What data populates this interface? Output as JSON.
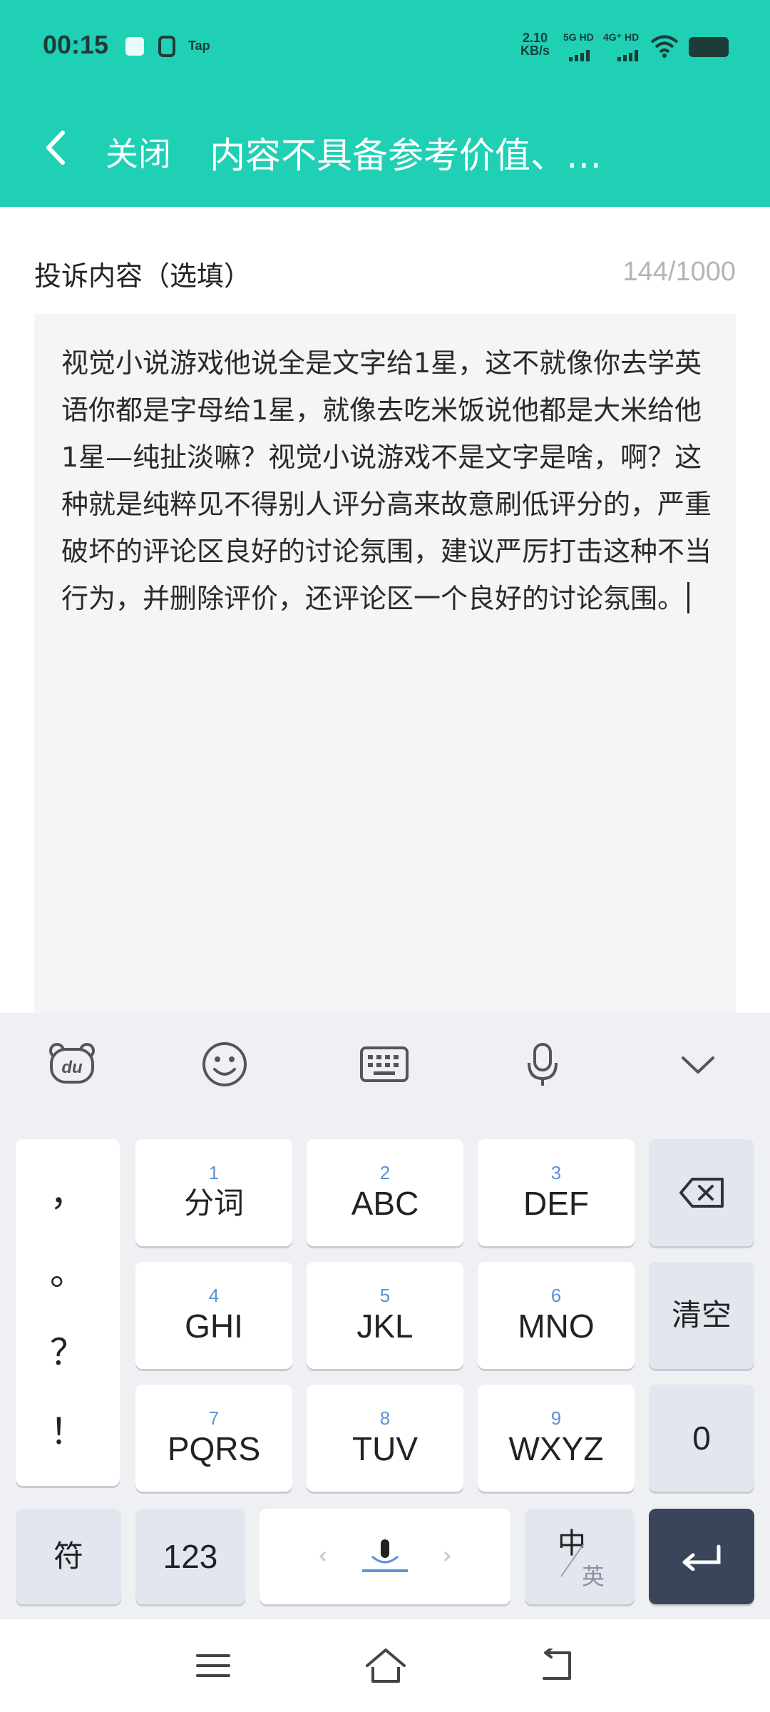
{
  "status_bar": {
    "time": "00:15",
    "app_icons": [
      "cloud-app-icon",
      "taptap-app-icon"
    ],
    "tap_label": "Tap",
    "net_speed_value": "2.10",
    "net_speed_unit": "KB/s",
    "sim1_label": "5G HD",
    "sim2_label": "4G⁺ HD",
    "battery_level": 1.0
  },
  "header": {
    "close_label": "关闭",
    "title": "内容不具备参考价值、…"
  },
  "form": {
    "label": "投诉内容（选填）",
    "counter": "144/1000",
    "content": "视觉小说游戏他说全是文字给1星，这不就像你去学英语你都是字母给1星，就像去吃米饭说他都是大米给他1星—纯扯淡嘛？视觉小说游戏不是文字是啥，啊？这种就是纯粹见不得别人评分高来故意刷低评分的，严重破坏的评论区良好的讨论氛围，建议严厉打击这种不当行为，并删除评价，还评论区一个良好的讨论氛围。"
  },
  "keyboard": {
    "toolbar": [
      "du-logo-icon",
      "emoji-icon",
      "keyboard-icon",
      "microphone-icon",
      "chevron-down-icon"
    ],
    "punctuation": [
      "，",
      "。",
      "？",
      "！"
    ],
    "keys": [
      {
        "num": "1",
        "label": "分词"
      },
      {
        "num": "2",
        "label": "ABC"
      },
      {
        "num": "3",
        "label": "DEF"
      },
      {
        "num": "4",
        "label": "GHI"
      },
      {
        "num": "5",
        "label": "JKL"
      },
      {
        "num": "6",
        "label": "MNO"
      },
      {
        "num": "7",
        "label": "PQRS"
      },
      {
        "num": "8",
        "label": "TUV"
      },
      {
        "num": "9",
        "label": "WXYZ"
      }
    ],
    "clear_label": "清空",
    "zero_label": "0",
    "symbol_label": "符",
    "num_label": "123",
    "lang_zh": "中",
    "lang_en": "英"
  },
  "nav_bar": [
    "menu-icon",
    "home-icon",
    "back-icon"
  ]
}
